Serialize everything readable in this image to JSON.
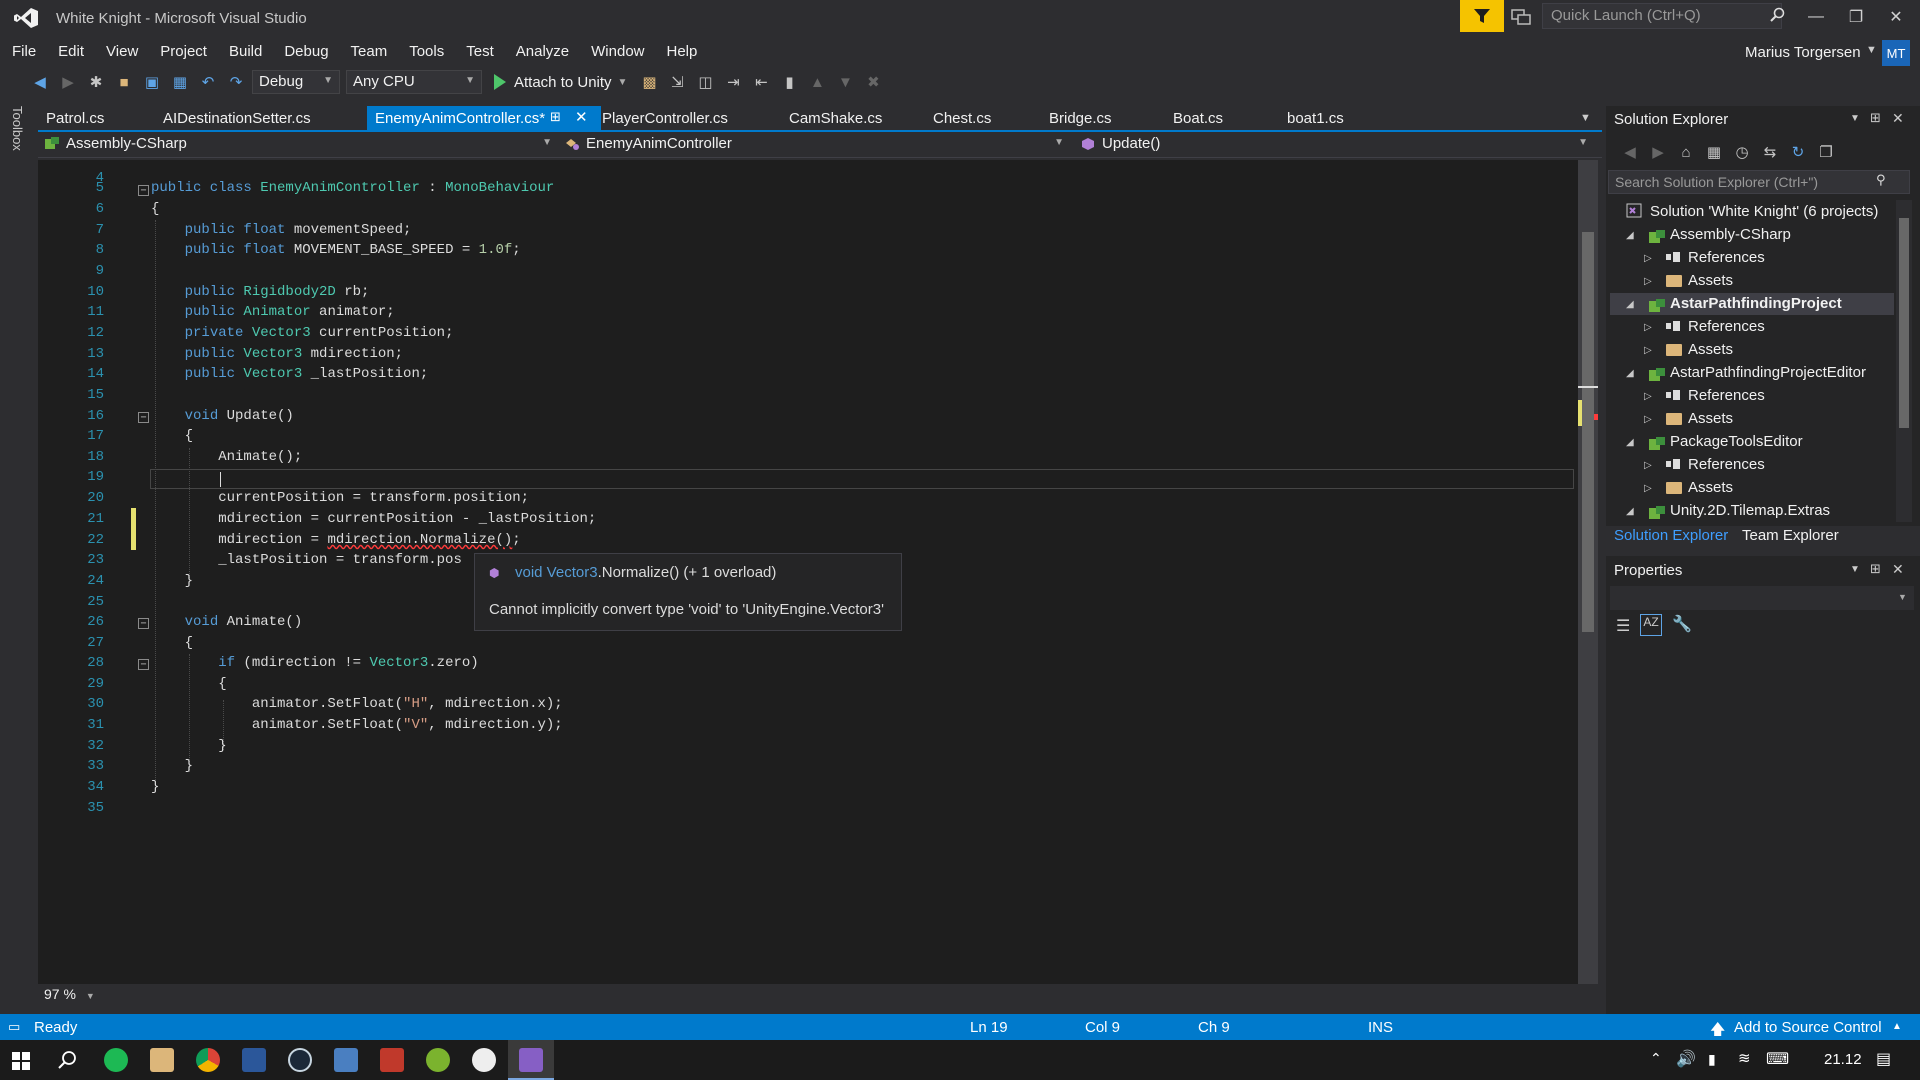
{
  "app": {
    "window_title": "White Knight - Microsoft Visual Studio",
    "quick_launch_placeholder": "Quick Launch (Ctrl+Q)",
    "user_name": "Marius Torgersen",
    "user_initials": "MT",
    "accent": "#007acc",
    "filter_color": "#f5c300"
  },
  "menu": [
    "File",
    "Edit",
    "View",
    "Project",
    "Build",
    "Debug",
    "Team",
    "Tools",
    "Test",
    "Analyze",
    "Window",
    "Help"
  ],
  "toolbar": {
    "configuration": "Debug",
    "platform": "Any CPU",
    "attach_label": "Attach to Unity"
  },
  "toolbox_label": "Toolbox",
  "tabs": [
    "Patrol.cs",
    "AIDestinationSetter.cs",
    "EnemyAnimController.cs*",
    "PlayerController.cs",
    "CamShake.cs",
    "Chest.cs",
    "Bridge.cs",
    "Boat.cs",
    "boat1.cs"
  ],
  "active_tab": "EnemyAnimController.cs*",
  "navbar": {
    "project": "Assembly-CSharp",
    "class": "EnemyAnimController",
    "member": "Update()"
  },
  "editor": {
    "line_numbers": [
      "4",
      "5",
      "6",
      "7",
      "8",
      "9",
      "10",
      "11",
      "12",
      "13",
      "14",
      "15",
      "16",
      "17",
      "18",
      "19",
      "20",
      "21",
      "22",
      "23",
      "24",
      "25",
      "26",
      "27",
      "28",
      "29",
      "30",
      "31",
      "32",
      "33",
      "34",
      "35"
    ],
    "tooltip": {
      "signature_type": "void Vector3",
      "signature_rest": ".Normalize() (+ 1 overload)",
      "error": "Cannot implicitly convert type 'void' to 'UnityEngine.Vector3'"
    },
    "zoom": "97 %"
  },
  "solution_explorer": {
    "title": "Solution Explorer",
    "search_placeholder": "Search Solution Explorer (Ctrl+\")",
    "solution": "Solution 'White Knight' (6 projects)",
    "items": [
      {
        "label": "Assembly-CSharp",
        "kind": "project"
      },
      {
        "label": "References",
        "kind": "references"
      },
      {
        "label": "Assets",
        "kind": "folder"
      },
      {
        "label": "AstarPathfindingProject",
        "kind": "project"
      },
      {
        "label": "References",
        "kind": "references"
      },
      {
        "label": "Assets",
        "kind": "folder"
      },
      {
        "label": "AstarPathfindingProjectEditor",
        "kind": "project"
      },
      {
        "label": "References",
        "kind": "references"
      },
      {
        "label": "Assets",
        "kind": "folder"
      },
      {
        "label": "PackageToolsEditor",
        "kind": "project"
      },
      {
        "label": "References",
        "kind": "references"
      },
      {
        "label": "Assets",
        "kind": "folder"
      },
      {
        "label": "Unity.2D.Tilemap.Extras",
        "kind": "project"
      }
    ],
    "tab_solution": "Solution Explorer",
    "tab_team": "Team Explorer"
  },
  "properties": {
    "title": "Properties"
  },
  "status": {
    "state": "Ready",
    "line": "Ln 19",
    "col": "Col 9",
    "ch": "Ch 9",
    "mode": "INS",
    "source_control": "Add to Source Control"
  },
  "taskbar": {
    "clock": "21.12"
  }
}
